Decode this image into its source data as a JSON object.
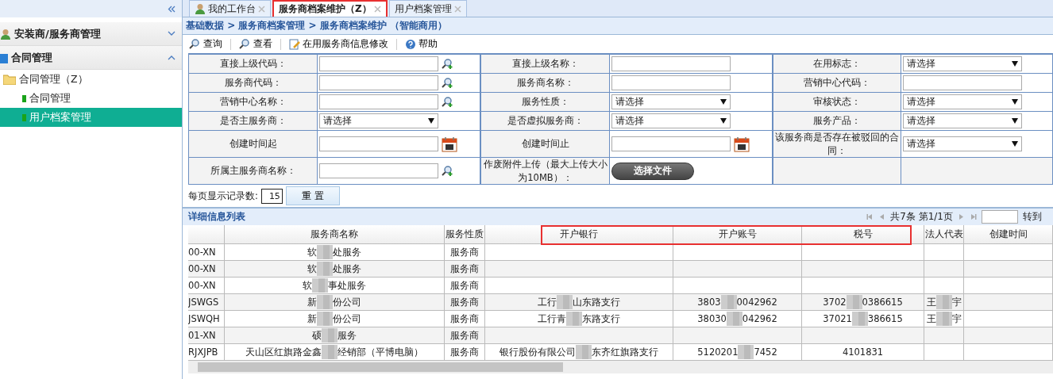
{
  "sidebar": {
    "groups": [
      {
        "title": "安装商/服务商管理",
        "expanded": false
      },
      {
        "title": "合同管理",
        "expanded": true,
        "tree": [
          {
            "label": "合同管理（Z）",
            "children": [
              {
                "label": "合同管理",
                "selected": false
              },
              {
                "label": "用户档案管理",
                "selected": true
              }
            ]
          }
        ]
      }
    ]
  },
  "tabs": [
    {
      "label": "我的工作台",
      "selected": false,
      "closable": true,
      "kind": "home"
    },
    {
      "label": "服务商档案维护（Z）",
      "selected": true,
      "closable": true,
      "kind": "page"
    },
    {
      "label": "用户档案管理",
      "selected": false,
      "closable": true,
      "kind": "page"
    }
  ],
  "breadcrumb": "基础数据 > 服务商档案管理 > 服务商档案维护 （智能商用）",
  "toolbar": [
    {
      "label": "查询",
      "kind": "search"
    },
    {
      "label": "查看",
      "kind": "search"
    },
    {
      "label": "在用服务商信息修改",
      "kind": "edit"
    },
    {
      "label": "帮助",
      "kind": "help"
    }
  ],
  "form": {
    "rows": [
      [
        {
          "label": "直接上级代码：",
          "kind": "lookup"
        },
        {
          "label": "直接上级名称：",
          "kind": "input"
        },
        {
          "label": "在用标志：",
          "kind": "select",
          "value": "请选择"
        }
      ],
      [
        {
          "label": "服务商代码：",
          "kind": "lookup"
        },
        {
          "label": "服务商名称：",
          "kind": "input"
        },
        {
          "label": "营销中心代码：",
          "kind": "input"
        }
      ],
      [
        {
          "label": "营销中心名称：",
          "kind": "lookup"
        },
        {
          "label": "服务性质：",
          "kind": "select",
          "value": "请选择"
        },
        {
          "label": "审核状态：",
          "kind": "select",
          "value": "请选择"
        }
      ],
      [
        {
          "label": "是否主服务商：",
          "kind": "select",
          "value": "请选择"
        },
        {
          "label": "是否虚拟服务商：",
          "kind": "select",
          "value": "请选择"
        },
        {
          "label": "服务产品：",
          "kind": "select",
          "value": "请选择"
        }
      ],
      [
        {
          "label": "创建时间起",
          "kind": "date"
        },
        {
          "label": "创建时间止",
          "kind": "date"
        },
        {
          "label": "该服务商是否存在被驳回的合同：",
          "kind": "select",
          "value": "请选择"
        }
      ],
      [
        {
          "label": "所属主服务商名称：",
          "kind": "lookup"
        },
        {
          "label": "作废附件上传（最大上传大小为10MB）：",
          "kind": "file",
          "button": "选择文件"
        },
        {
          "kind": "empty"
        }
      ]
    ],
    "page_size_label": "每页显示记录数:",
    "page_size": "15",
    "reset_button": "重 置"
  },
  "list": {
    "title": "详细信息列表",
    "pager": "共7条 第1/1页",
    "goto": "转到",
    "columns": [
      {
        "highlighted": false
      },
      {
        "label": "服务商名称",
        "highlighted": false
      },
      {
        "label": "服务性质",
        "highlighted": false
      },
      {
        "label": "开户银行",
        "highlighted": true
      },
      {
        "label": "开户账号",
        "highlighted": true
      },
      {
        "label": "税号",
        "highlighted": true
      },
      {
        "label": "法人代表",
        "highlighted": false
      },
      {
        "label": "创建时间",
        "highlighted": false
      }
    ],
    "rows": [
      [
        [
          "00-XN"
        ],
        [
          "软",
          "处服务"
        ],
        [
          "服务商"
        ],
        [],
        [],
        [],
        [],
        []
      ],
      [
        [
          "00-XN"
        ],
        [
          "软",
          "处服务"
        ],
        [
          "服务商"
        ],
        [],
        [],
        [],
        [],
        []
      ],
      [
        [
          "00-XN"
        ],
        [
          "软",
          "事处服务"
        ],
        [
          "服务商"
        ],
        [],
        [],
        [],
        [],
        []
      ],
      [
        [
          "JSWGS"
        ],
        [
          "新",
          "份公司"
        ],
        [
          "服务商"
        ],
        [
          "工行",
          "山东路支行"
        ],
        [
          "3803",
          "0042962"
        ],
        [
          "3702",
          "0386615"
        ],
        [
          "王",
          "宇"
        ],
        []
      ],
      [
        [
          "JSWQH"
        ],
        [
          "新",
          "份公司"
        ],
        [
          "服务商"
        ],
        [
          "工行青",
          "东路支行"
        ],
        [
          "38030",
          "042962"
        ],
        [
          "37021",
          "386615"
        ],
        [
          "王",
          "宇"
        ],
        []
      ],
      [
        [
          "01-XN"
        ],
        [
          "硕",
          "服务"
        ],
        [
          "服务商"
        ],
        [],
        [],
        [],
        [],
        []
      ],
      [
        [
          "RJXJPB"
        ],
        [
          "天山区红旗路金鑫",
          "经销部（平博电脑）"
        ],
        [
          "服务商"
        ],
        [
          "银行股份有限公司",
          "东齐红旗路支行"
        ],
        [
          "5120201",
          "7452"
        ],
        [
          "4101831"
        ],
        [],
        []
      ]
    ]
  }
}
